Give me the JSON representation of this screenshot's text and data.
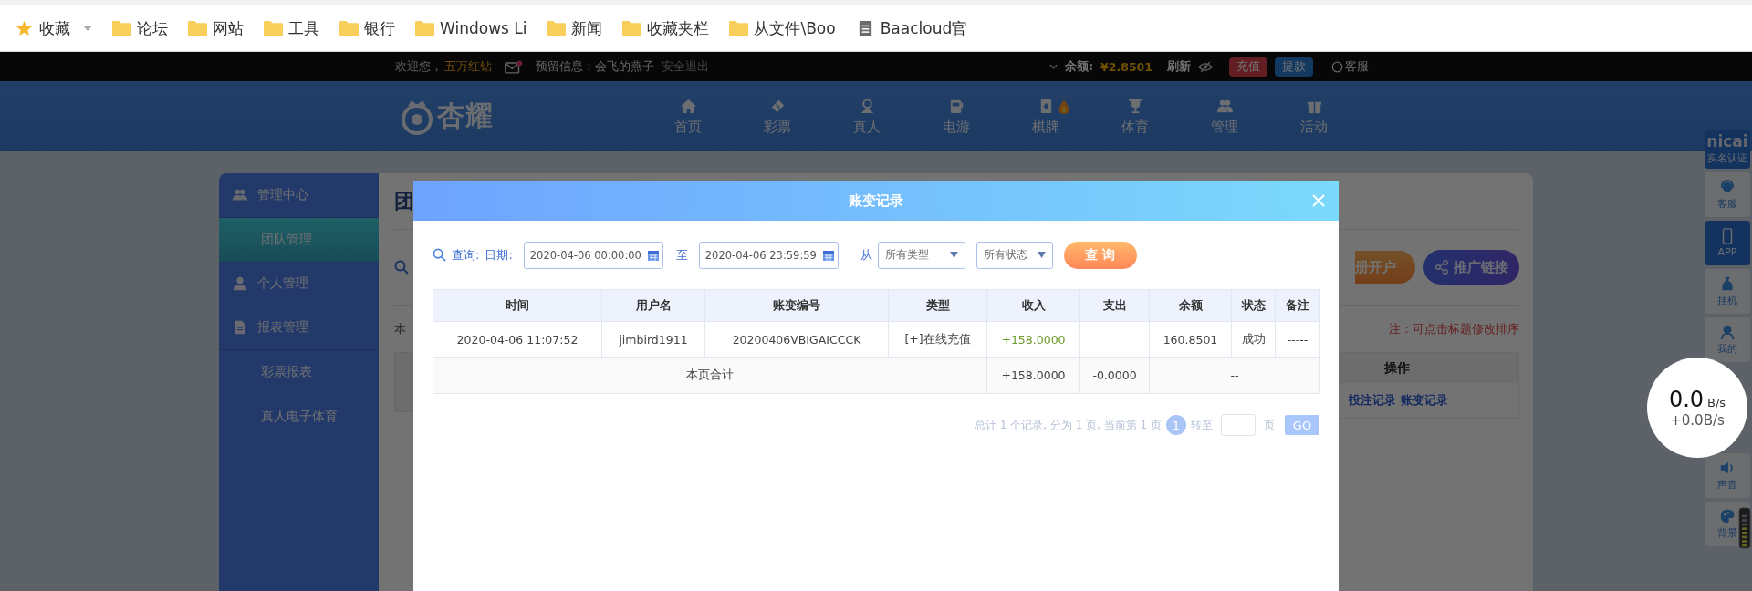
{
  "bookmarks": [
    {
      "label": "收藏",
      "kind": "star"
    },
    {
      "label": "论坛",
      "kind": "folder"
    },
    {
      "label": "网站",
      "kind": "folder"
    },
    {
      "label": "工具",
      "kind": "folder"
    },
    {
      "label": "银行",
      "kind": "folder"
    },
    {
      "label": "Windows Li",
      "kind": "folder"
    },
    {
      "label": "新闻",
      "kind": "folder"
    },
    {
      "label": "收藏夹栏",
      "kind": "folder"
    },
    {
      "label": "从文件\\Boo",
      "kind": "folder"
    },
    {
      "label": "Baacloud官",
      "kind": "page"
    }
  ],
  "top_bar": {
    "welcome": "欢迎您，",
    "username": "五万红钻",
    "has_unread_mail": true,
    "reserved_info": "预留信息：会飞的燕子",
    "logout": "安全退出",
    "balance_label": "余额:",
    "balance": "¥2.8501",
    "refresh": "刷新",
    "deposit": "充值",
    "withdraw": "提款",
    "service": "客服"
  },
  "logo": "杏耀",
  "nav": [
    {
      "label": "首页",
      "hot": false
    },
    {
      "label": "彩票",
      "hot": false
    },
    {
      "label": "真人",
      "hot": false
    },
    {
      "label": "电游",
      "hot": false
    },
    {
      "label": "棋牌",
      "hot": true
    },
    {
      "label": "体育",
      "hot": false
    },
    {
      "label": "管理",
      "hot": false
    },
    {
      "label": "活动",
      "hot": false
    }
  ],
  "sidebar": {
    "items": [
      {
        "label": "管理中心",
        "kind": "section",
        "selected": false
      },
      {
        "label": "团队管理",
        "kind": "link",
        "selected": true
      },
      {
        "label": "个人管理",
        "kind": "section",
        "selected": false
      },
      {
        "label": "报表管理",
        "kind": "section",
        "selected": false
      },
      {
        "label": "彩票报表",
        "kind": "link",
        "selected": false
      },
      {
        "label": "真人电子体育",
        "kind": "link",
        "selected": false
      }
    ]
  },
  "content": {
    "title": "团",
    "text": "本",
    "open_account_button": "册开户",
    "promo_link_button": "推广链接",
    "note": "注：可点击标题修改排序",
    "table": {
      "column": "操作",
      "actions": [
        "投注记录",
        "账变记录"
      ]
    }
  },
  "modal": {
    "title": "账变记录",
    "query": {
      "label": "查询:",
      "date_label": "日期:",
      "start": "2020-04-06 00:00:00",
      "to": "至",
      "end": "2020-04-06 23:59:59",
      "from": "从",
      "type_filter": "所有类型",
      "status_filter": "所有状态",
      "button": "查 询"
    },
    "table": {
      "columns": [
        "时间",
        "用户名",
        "账变编号",
        "类型",
        "收入",
        "支出",
        "余额",
        "状态",
        "备注"
      ],
      "rows": [
        {
          "time": "2020-04-06 11:07:52",
          "username": "jimbird1911",
          "id": "20200406VBIGAICCCK",
          "type": "[+]在线充值",
          "income": "+158.0000",
          "balance": "160.8501",
          "status": "成功",
          "note": "-----"
        }
      ],
      "total": {
        "label": "本页合计",
        "income": "+158.0000",
        "expense": "-0.0000",
        "rest": "--"
      }
    },
    "pagination": {
      "summary": "总计 1 个记录, 分为 1 页, 当前第 1 页",
      "pages": [
        {
          "label": "1",
          "selected": true
        }
      ],
      "goto": "转至",
      "page_unit": "页",
      "go": "GO"
    }
  },
  "side_widgets": {
    "upper": [
      {
        "kind": "brand",
        "logo": "nicai",
        "label": "实名认证",
        "highlighted": true
      },
      {
        "kind": "tile",
        "label": "客服",
        "highlighted": false
      },
      {
        "kind": "tile",
        "label": "APP",
        "highlighted": true
      },
      {
        "kind": "tile",
        "label": "挂机",
        "highlighted": false
      },
      {
        "kind": "tile",
        "label": "我的",
        "highlighted": false
      }
    ],
    "lower": [
      {
        "kind": "tile",
        "label": "声音",
        "highlighted": false
      },
      {
        "kind": "tile",
        "label": "背景",
        "highlighted": false
      }
    ]
  },
  "speed": {
    "rate": "0.0",
    "unit": "B/s",
    "delta": "+0.0B/s"
  }
}
